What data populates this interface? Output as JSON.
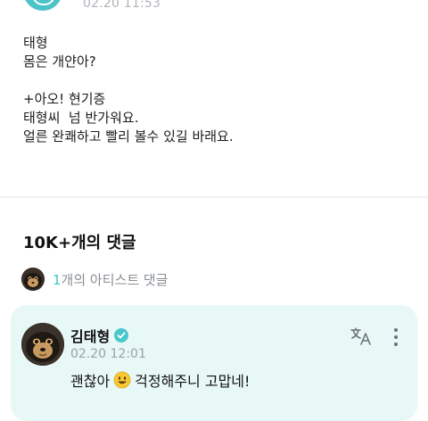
{
  "post": {
    "time": "02.20 11:53",
    "lines": [
      "태형",
      "몸은 개얀아?",
      "",
      "+아오! 현기증",
      "태형씨  넘 반가워요.",
      "얼른 완쾌하고 빨리 볼수 있길 바래요."
    ]
  },
  "comments": {
    "count_label": "10K+개의 댓글",
    "artist_count": "1",
    "artist_label": "개의 아티스트 댓글"
  },
  "artist_comment": {
    "name": "김태형",
    "time": "02.20 12:01",
    "text_before": "괜찮아",
    "text_after": " 걱정해주니 고맙네!"
  },
  "icons": {
    "verified": "verified-check-icon",
    "translate": "translate-icon",
    "more": "more-vertical-icon",
    "emoji": "smiley-emoji-icon"
  },
  "colors": {
    "accent": "#3fc6c9",
    "card_bg": "#e8f8f7"
  }
}
